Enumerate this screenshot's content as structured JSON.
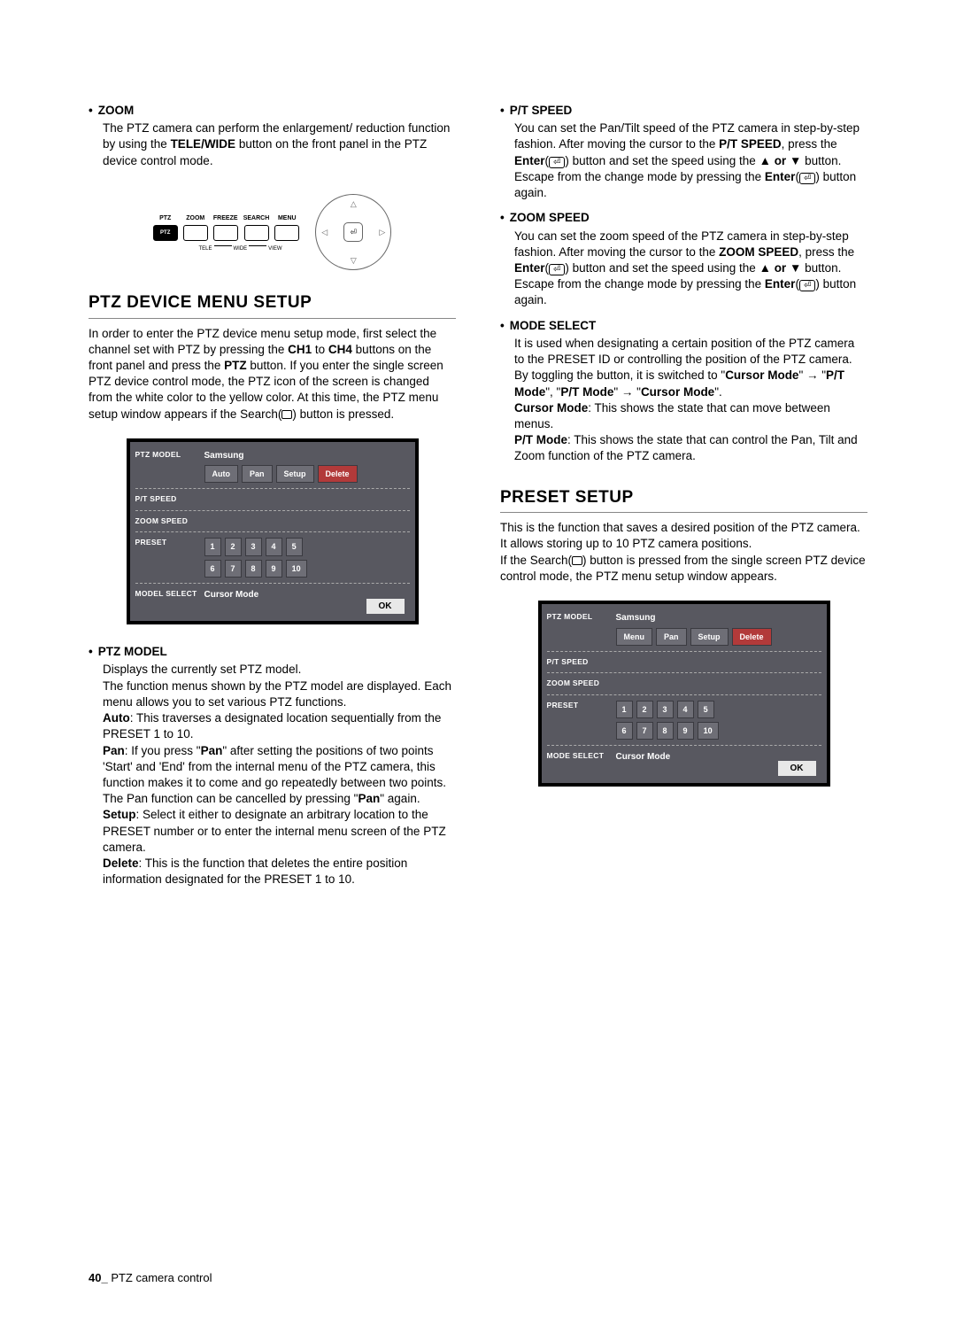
{
  "leftCol": {
    "zoom": {
      "label": "ZOOM",
      "body_a": "The PTZ camera can perform the enlargement/ reduction function by using the ",
      "body_b": "TELE/WIDE",
      "body_c": " button on the front panel in the PTZ device control mode."
    },
    "panel": {
      "ptz": "PTZ",
      "zoom": "ZOOM",
      "freeze": "FREEZE",
      "search": "SEARCH",
      "menu": "MENU",
      "tele": "TELE",
      "wide": "WIDE",
      "view": "VIEW"
    },
    "ptzSetup": {
      "heading": "PTZ DEVICE MENU SETUP",
      "intro_a": "In order to enter the PTZ device menu setup mode, first select the channel set with PTZ by pressing the ",
      "intro_b": "CH1",
      "intro_c": " to ",
      "intro_d": "CH4",
      "intro_e": " buttons on the front panel and press the ",
      "intro_f": "PTZ",
      "intro_g": " button. If you enter the single screen PTZ device control mode, the PTZ icon of the screen is changed from the white color to the yellow color. At this time, the PTZ menu setup window appears if the Search(",
      "intro_h": ") button is pressed."
    },
    "menuTable1": {
      "r1_label": "PTZ MODEL",
      "r1_value": "Samsung",
      "chips": [
        "Auto",
        "Pan",
        "Setup",
        "Delete"
      ],
      "r2_label": "P/T SPEED",
      "r3_label": "ZOOM SPEED",
      "r4_label": "PRESET",
      "presets": [
        "1",
        "2",
        "3",
        "4",
        "5",
        "6",
        "7",
        "8",
        "9",
        "10"
      ],
      "r5_label": "MODEL SELECT",
      "r5_value": "Cursor Mode",
      "ok": "OK"
    },
    "ptzModel": {
      "label": "PTZ MODEL",
      "p1": "Displays the currently set PTZ model.",
      "p2": "The function menus shown by the PTZ model are displayed. Each menu allows you to set various PTZ functions.",
      "auto_b": "Auto",
      "auto_t": ": This traverses a designated location sequentially from the PRESET 1 to 10.",
      "pan_b": "Pan",
      "pan_t1": ": If you press \"",
      "pan_t2": "Pan",
      "pan_t3": "\" after setting the positions of two points 'Start' and 'End' from the internal menu of the PTZ camera, this function makes it to come and go repeatedly between two points. The Pan function can be cancelled by pressing \"",
      "pan_t4": "Pan",
      "pan_t5": "\" again.",
      "setup_b": "Setup",
      "setup_t": ": Select it either to designate an arbitrary location to the PRESET number or to enter the internal menu screen of the PTZ camera.",
      "del_b": "Delete",
      "del_t": ": This is the function that deletes the entire position information designated for the PRESET 1 to 10."
    }
  },
  "rightCol": {
    "ptSpeed": {
      "label": "P/T SPEED",
      "a": "You can set the Pan/Tilt speed of the PTZ camera in step-by-step fashion. After moving the cursor to the ",
      "b": "P/T SPEED",
      "c": ", press the ",
      "d": "Enter",
      "e": " button and set the speed using the ",
      "f": "▲ or ▼",
      "g": " button. Escape from the change mode by pressing the ",
      "h": "Enter",
      "i": " button again."
    },
    "zoomSpeed": {
      "label": "ZOOM SPEED",
      "a": "You can set the zoom speed of the PTZ camera in step-by-step fashion. After moving the cursor to the ",
      "b": "ZOOM SPEED",
      "c": ", press the ",
      "d": "Enter",
      "e": " button and set the speed using the ",
      "f": "▲ or ▼",
      "g": " button. Escape from the change mode by pressing the ",
      "h": "Enter",
      "i": " button again."
    },
    "modeSelect": {
      "label": "MODE SELECT",
      "a": "It is used when designating a certain position of the PTZ camera to the PRESET ID or controlling the position of the PTZ camera. By toggling the button, it is switched to \"",
      "b": "Cursor Mode",
      "c": "\" → \"",
      "d": "P/T Mode",
      "e": "\", \"",
      "f": "P/T Mode",
      "g": "\" → \"",
      "h": "Cursor Mode",
      "i": "\".",
      "cm_b": "Cursor Mode",
      "cm_t": ": This shows the state that can move between menus.",
      "pt_b": "P/T Mode",
      "pt_t": ": This shows the state that can control the Pan, Tilt and Zoom function of the PTZ camera."
    },
    "presetSetup": {
      "heading": "PRESET SETUP",
      "p1": "This is the function that saves a desired position of the PTZ camera.",
      "p2": "It allows storing up to 10 PTZ camera positions.",
      "p3a": "If the Search(",
      "p3b": ") button is pressed from the single screen PTZ device control mode, the PTZ menu setup window appears."
    },
    "menuTable2": {
      "r1_label": "PTZ MODEL",
      "r1_value": "Samsung",
      "chips": [
        "Menu",
        "Pan",
        "Setup",
        "Delete"
      ],
      "r2_label": "P/T SPEED",
      "r3_label": "ZOOM SPEED",
      "r4_label": "PRESET",
      "presets": [
        "1",
        "2",
        "3",
        "4",
        "5",
        "6",
        "7",
        "8",
        "9",
        "10"
      ],
      "r5_label": "MODE SELECT",
      "r5_value": "Cursor Mode",
      "ok": "OK"
    }
  },
  "footer": {
    "page": "40_",
    "section": " PTZ camera control"
  }
}
